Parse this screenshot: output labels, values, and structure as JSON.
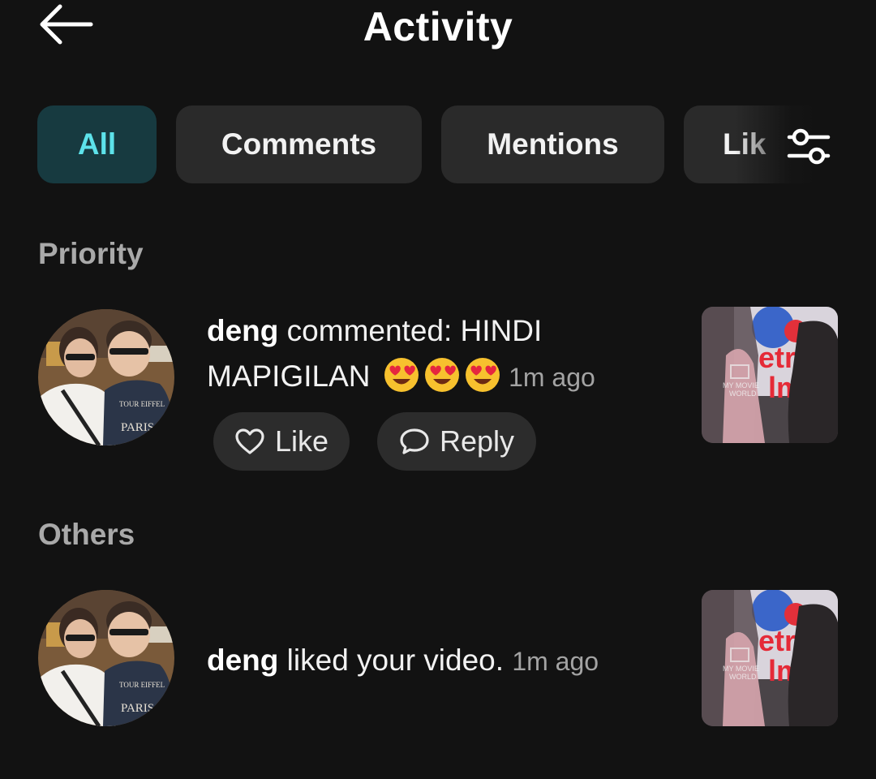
{
  "header": {
    "title": "Activity"
  },
  "tabs": {
    "all": "All",
    "comments": "Comments",
    "mentions": "Mentions",
    "likes": "Lik"
  },
  "sections": {
    "priority": "Priority",
    "others": "Others"
  },
  "priority_item": {
    "username": "deng",
    "action": "commented: HINDI MAPIGILAN",
    "emojis": [
      "heart-eyes-emoji",
      "heart-eyes-emoji",
      "heart-eyes-emoji"
    ],
    "time": "1m ago",
    "like_label": "Like",
    "reply_label": "Reply"
  },
  "other_item": {
    "username": "deng",
    "action": "liked your video.",
    "time": "1m ago"
  },
  "thumbnail": {
    "watermark_line1": "MY MOVIE",
    "watermark_line2": "WORLD",
    "sign_text": "etr",
    "sign_text2": "lm"
  },
  "colors": {
    "background": "#121212",
    "active_tab_bg": "#173a40",
    "active_tab_text": "#5de2ea",
    "chip_bg": "#2a2a2a"
  }
}
